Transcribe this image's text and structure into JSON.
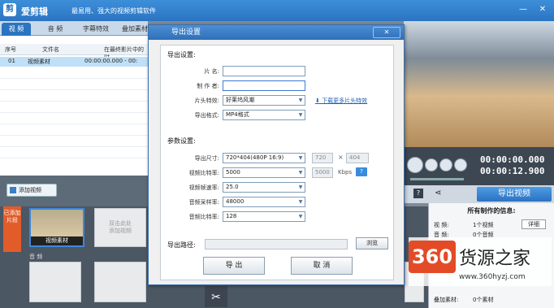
{
  "app": {
    "name": "爱剪辑",
    "slogan": "最易用、强大的视频剪辑软件"
  },
  "tabs": [
    {
      "label": "视 频"
    },
    {
      "label": "音 频"
    },
    {
      "label": "字幕特效"
    },
    {
      "label": "叠加素材"
    }
  ],
  "filelist": {
    "headers": [
      "序号",
      "文件名",
      "在最终影片中的时"
    ],
    "rows": [
      {
        "index": "01",
        "name": "视频素材",
        "time": "00:00:00.000 - 00:"
      }
    ]
  },
  "add_video_label": "添加视频",
  "storyboard": {
    "side_label": "已添加片段",
    "clip_caption": "视频素材",
    "empty_slot_text": "双击此处\n添加视频",
    "audio_label": "音 频"
  },
  "player": {
    "time_current": "00:00:00.000",
    "time_total": "00:00:12.900"
  },
  "export_button": "导出视频",
  "info": {
    "title": "所有制作的信息:",
    "rows": [
      {
        "k": "视 频:",
        "v": "1个视频",
        "btn": "详细"
      },
      {
        "k": "音 频:",
        "v": "0个音频"
      },
      {
        "k": "叠加素材:",
        "v": "0个素材"
      }
    ]
  },
  "dialog": {
    "title": "导出设置",
    "close": "✕",
    "export_section": "导出设置:",
    "name_label": "片 名:",
    "name_value": "",
    "author_label": "制 作 者:",
    "author_value": "",
    "opening_label": "片头特效:",
    "opening_value": "好莱坞风潮",
    "download_link": "下载更多片头特效",
    "format_label": "导出格式:",
    "format_value": "MP4格式",
    "param_section": "参数设置:",
    "size_label": "导出尺寸:",
    "size_value": "720*404(480P 16:9)",
    "width_value": "720",
    "times": "×",
    "height_value": "404",
    "vbitrate_label": "视频比特率:",
    "vbitrate_value": "5000",
    "vbitrate_custom": "5000",
    "kbps": "Kbps",
    "help": "?",
    "fps_label": "视频帧速率:",
    "fps_value": "25.0",
    "samplerate_label": "音频采样率:",
    "samplerate_value": "48000",
    "abitrate_label": "音频比特率:",
    "abitrate_value": "128",
    "path_label": "导出路径:",
    "path_value": "",
    "browse": "浏览",
    "ok": "导 出",
    "cancel": "取 消"
  },
  "watermark": {
    "logo": "360",
    "text": "货源之家",
    "url": "www.360hyzj.com"
  }
}
